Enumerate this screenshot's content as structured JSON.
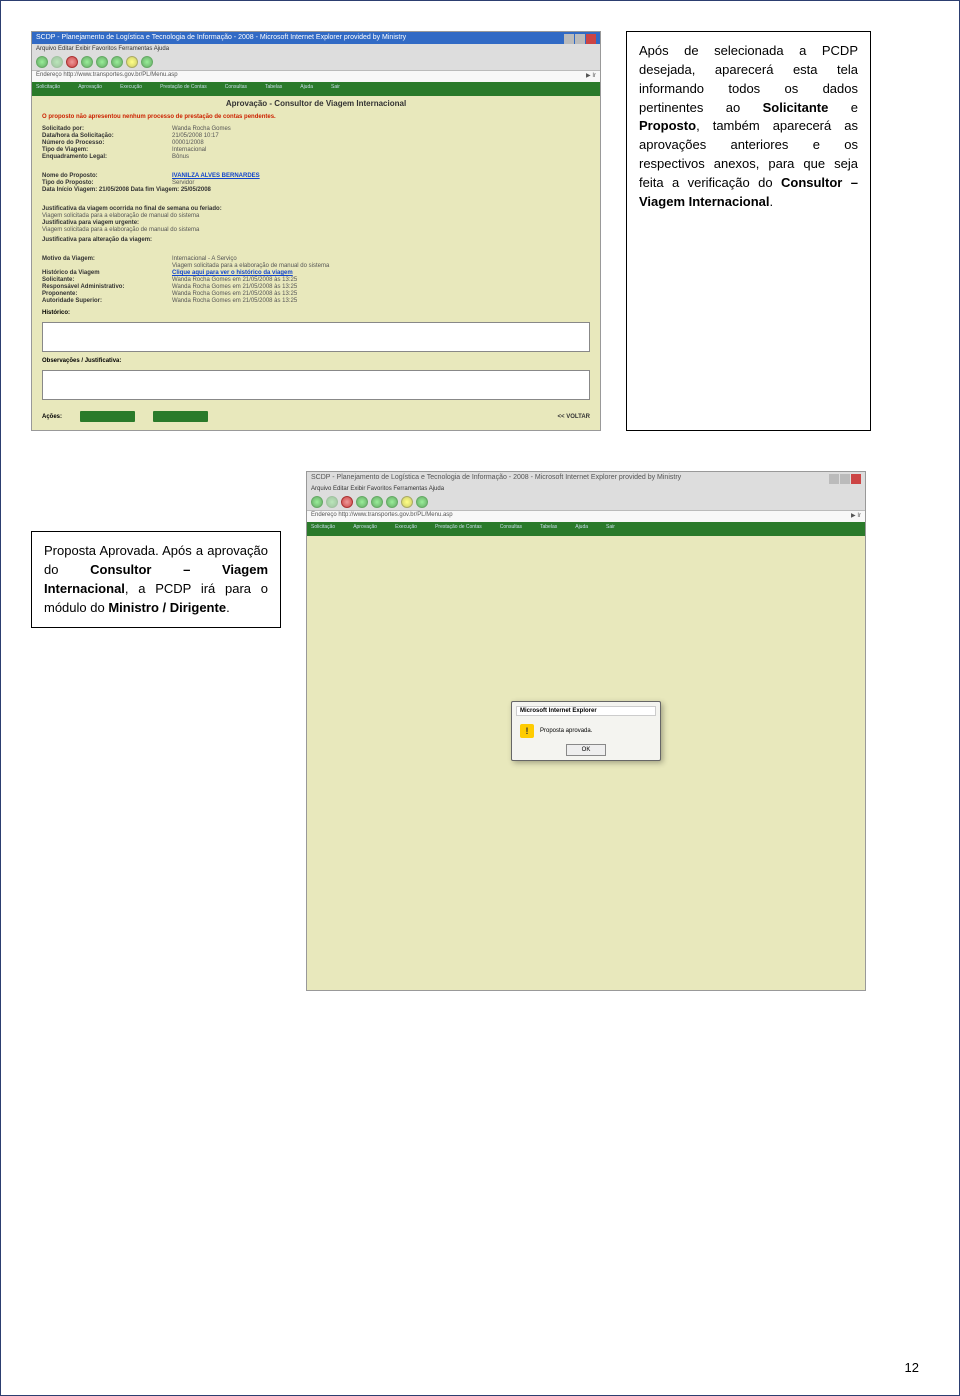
{
  "screenshot1": {
    "windowTitle": "SCDP - Planejamento de Logística e Tecnologia de Informação - 2008 - Microsoft Internet Explorer provided by Ministry",
    "menu": "Arquivo   Editar   Exibir   Favoritos   Ferramentas   Ajuda",
    "pageTitle": "Aprovação - Consultor de Viagem Internacional",
    "notice": "O proposto não apresentou nenhum processo de prestação de contas pendentes.",
    "fields": {
      "solicitado": {
        "label": "Solicitado por:",
        "value": "Wanda Rocha Gomes"
      },
      "dataHora": {
        "label": "Data/hora da Solicitação:",
        "value": "21/05/2008  10:17"
      },
      "numero": {
        "label": "Número do Processo:",
        "value": "00001/2008"
      },
      "tipoViagem": {
        "label": "Tipo de Viagem:",
        "value": "Internacional"
      },
      "enquadramento": {
        "label": "Enquadramento Legal:",
        "value": "Bônus"
      }
    },
    "proponente": {
      "nome": {
        "label": "Nome do Proposto:",
        "value": "IVANILZA ALVES BERNARDES"
      },
      "tipo": {
        "label": "Tipo do Proposto:",
        "value": "Servidor"
      },
      "dataInicio": {
        "label": "Data Início Viagem: 21/05/2008 Data fim Viagem: 25/05/2008"
      }
    },
    "justifTitle": "Justificativa da viagem ocorrida no final de semana ou feriado:",
    "justifLine1": "Viagem solicitada para a elaboração de manual do sistema",
    "justifUrg": "Justificativa para viagem urgente:",
    "justifLine2": "Viagem solicitada para a elaboração de manual do sistema",
    "justifAlt": "Justificativa para alteração da viagem:",
    "motivo": {
      "label": "Motivo da Viagem:",
      "value1": "Internacional - A Serviço",
      "value2": "Viagem solicitada para a elaboração de manual do sistema"
    },
    "historicoLabel": "Histórico da Viagem",
    "historicoLink": "Clique aqui para ver o histórico da viagem",
    "solicitante": {
      "label": "Solicitante:",
      "value": "Wanda Rocha Gomes em 21/05/2008 às 13:25"
    },
    "respAdm": {
      "label": "Responsável Administrativo:",
      "value": "Wanda Rocha Gomes em 21/05/2008 às 13:25"
    },
    "propLabel": {
      "label": "Proponente:",
      "value": "Wanda Rocha Gomes em 21/05/2008 às 13:25"
    },
    "autSup": {
      "label": "Autoridade Superior:",
      "value": "Wanda Rocha Gomes em 21/05/2008 às 13:25"
    },
    "historicoSection": "Histórico:",
    "obsSection": "Observações / Justificativa:",
    "acoes": "Ações:",
    "voltar": "<< VOLTAR"
  },
  "callout1": {
    "line1a": "Após de selecionada a PCDP desejada, aparecerá esta tela informando todos os dados pertinentes ao ",
    "line1b": "Solicitante",
    "line1c": " e ",
    "line1d": "Proposto",
    "line1e": ", também aparecerá as aprovações anteriores e os respectivos anexos, para que seja feita a verificação do ",
    "line1f": "Consultor – Viagem Internacional",
    "line1g": "."
  },
  "callout2": {
    "line2a": "Proposta Aprovada. Após a aprovação do ",
    "line2b": "Consultor – Viagem Internacional",
    "line2c": ", a PCDP irá para o módulo do ",
    "line2d": "Ministro / Dirigente",
    "line2e": "."
  },
  "screenshot2": {
    "popupTitle": "Microsoft Internet Explorer",
    "popupText": "Proposta aprovada.",
    "popupOk": "OK"
  },
  "pageNumber": "12"
}
